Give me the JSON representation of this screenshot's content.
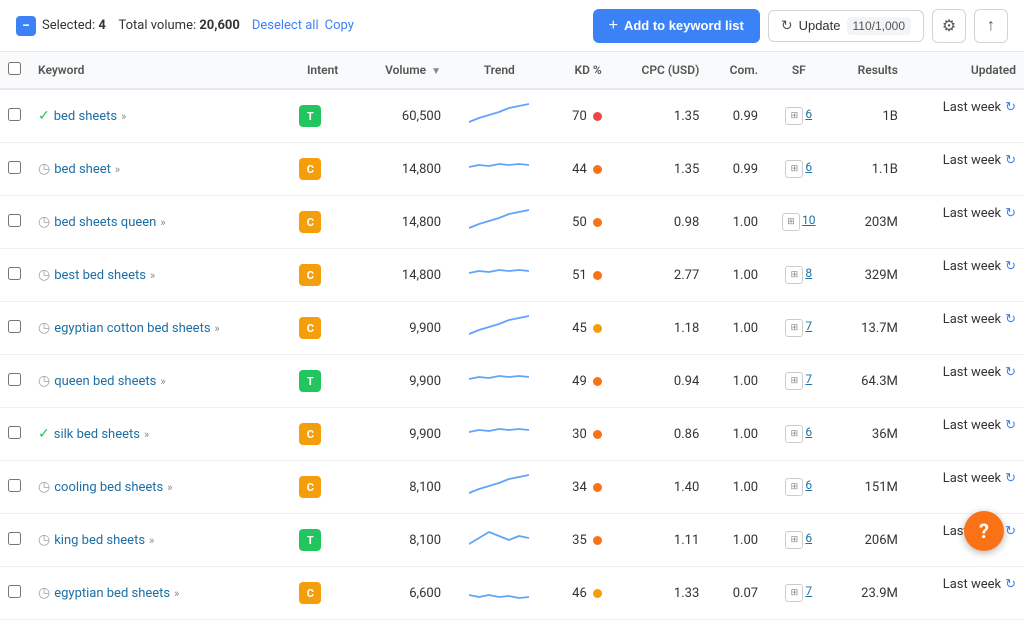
{
  "topBar": {
    "selectedLabel": "Selected:",
    "selectedCount": "4",
    "totalVolumeLabel": "Total volume:",
    "totalVolume": "20,600",
    "deselectAllLabel": "Deselect all",
    "copyLabel": "Copy",
    "addKeywordLabel": "Add to keyword list",
    "updateLabel": "Update",
    "updateCount": "110/1,000"
  },
  "table": {
    "headers": {
      "keyword": "Keyword",
      "intent": "Intent",
      "volume": "Volume",
      "trend": "Trend",
      "kd": "KD %",
      "cpc": "CPC (USD)",
      "com": "Com.",
      "sf": "SF",
      "results": "Results",
      "updated": "Updated"
    },
    "rows": [
      {
        "id": 1,
        "keyword": "bed sheets",
        "iconType": "verified-green",
        "intent": "T",
        "intentClass": "intent-t",
        "volume": "60,500",
        "kd": "70",
        "kdDotClass": "dot-red",
        "cpc": "1.35",
        "com": "0.99",
        "sf": "6",
        "results": "1B",
        "updated": "Last week",
        "trend": "up"
      },
      {
        "id": 2,
        "keyword": "bed sheet",
        "iconType": "verified-gray",
        "intent": "C",
        "intentClass": "intent-c",
        "volume": "14,800",
        "kd": "44",
        "kdDotClass": "dot-orange",
        "cpc": "1.35",
        "com": "0.99",
        "sf": "6",
        "results": "1.1B",
        "updated": "Last week",
        "trend": "flat"
      },
      {
        "id": 3,
        "keyword": "bed sheets queen",
        "iconType": "verified-gray",
        "intent": "C",
        "intentClass": "intent-c",
        "volume": "14,800",
        "kd": "50",
        "kdDotClass": "dot-orange",
        "cpc": "0.98",
        "com": "1.00",
        "sf": "10",
        "results": "203M",
        "updated": "Last week",
        "trend": "up"
      },
      {
        "id": 4,
        "keyword": "best bed sheets",
        "iconType": "verified-gray",
        "intent": "C",
        "intentClass": "intent-c",
        "volume": "14,800",
        "kd": "51",
        "kdDotClass": "dot-orange",
        "cpc": "2.77",
        "com": "1.00",
        "sf": "8",
        "results": "329M",
        "updated": "Last week",
        "trend": "flat"
      },
      {
        "id": 5,
        "keyword": "egyptian cotton bed sheets",
        "iconType": "verified-gray",
        "intent": "C",
        "intentClass": "intent-c",
        "volume": "9,900",
        "kd": "45",
        "kdDotClass": "dot-yellow",
        "cpc": "1.18",
        "com": "1.00",
        "sf": "7",
        "results": "13.7M",
        "updated": "Last week",
        "trend": "up"
      },
      {
        "id": 6,
        "keyword": "queen bed sheets",
        "iconType": "verified-gray",
        "intent": "T",
        "intentClass": "intent-t",
        "volume": "9,900",
        "kd": "49",
        "kdDotClass": "dot-orange",
        "cpc": "0.94",
        "com": "1.00",
        "sf": "7",
        "results": "64.3M",
        "updated": "Last week",
        "trend": "flat"
      },
      {
        "id": 7,
        "keyword": "silk bed sheets",
        "iconType": "verified-green",
        "intent": "C",
        "intentClass": "intent-c",
        "volume": "9,900",
        "kd": "30",
        "kdDotClass": "dot-orange",
        "cpc": "0.86",
        "com": "1.00",
        "sf": "6",
        "results": "36M",
        "updated": "Last week",
        "trend": "flat"
      },
      {
        "id": 8,
        "keyword": "cooling bed sheets",
        "iconType": "verified-gray",
        "intent": "C",
        "intentClass": "intent-c",
        "volume": "8,100",
        "kd": "34",
        "kdDotClass": "dot-orange",
        "cpc": "1.40",
        "com": "1.00",
        "sf": "6",
        "results": "151M",
        "updated": "Last week",
        "trend": "up"
      },
      {
        "id": 9,
        "keyword": "king bed sheets",
        "iconType": "verified-gray",
        "intent": "T",
        "intentClass": "intent-t",
        "volume": "8,100",
        "kd": "35",
        "kdDotClass": "dot-orange",
        "cpc": "1.11",
        "com": "1.00",
        "sf": "6",
        "results": "206M",
        "updated": "Last week",
        "trend": "up-down"
      },
      {
        "id": 10,
        "keyword": "egyptian bed sheets",
        "iconType": "verified-gray",
        "intent": "C",
        "intentClass": "intent-c",
        "volume": "6,600",
        "kd": "46",
        "kdDotClass": "dot-yellow",
        "cpc": "1.33",
        "com": "0.07",
        "sf": "7",
        "results": "23.9M",
        "updated": "Last week",
        "trend": "flat-low"
      }
    ]
  },
  "help": {
    "label": "?"
  }
}
